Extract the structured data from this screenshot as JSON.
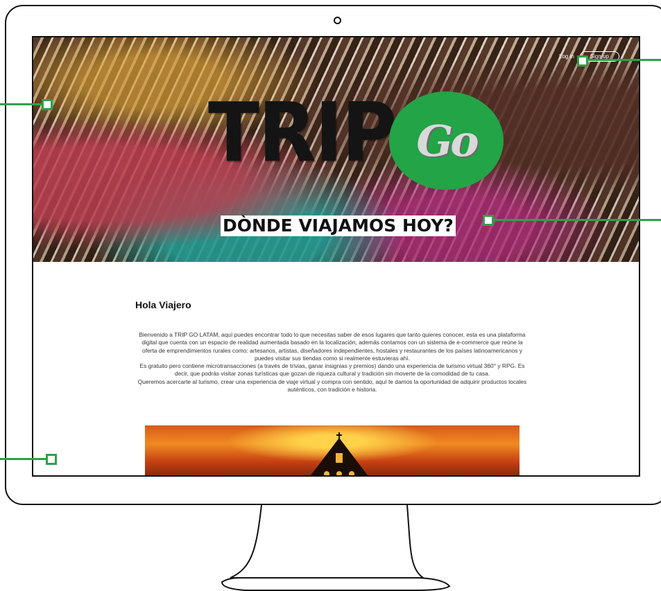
{
  "brand": {
    "logo_text": "TRIP",
    "logo_badge": "Go",
    "accent_color": "#22a447"
  },
  "hero": {
    "tagline": "DÒNDE VIAJAMOS HOY?"
  },
  "auth": {
    "login_label": "Log in",
    "signup_label": "Sign up"
  },
  "content": {
    "title": "Hola Viajero",
    "paragraphs": [
      "Bienvenido a TRIP GO LATAM, aquí puedes encontrar todo lo que necesitas saber de esos lugares que tanto quieres conocer, esta es una plataforma digital que cuenta con un espacio de realidad aumentada basado en la localización, además contamos con un sistema de e-commerce que reúne la oferta de emprendimientos rurales como: artesanos, artistas, diseñadores independientes, hostales y restaurantes de los países latinoamericanos y puedes visitar sus tiendas como si realmente estuvieras ahí.",
      "Es gratuito pero contiene microtransacciones (a través de trivias, ganar insignias y premios)  dando una experiencia de turismo virtual 360° y RPG. Es decir, que podrás visitar zonas turísticas que gozan de riqueza cultural y tradición sin moverte de la comodidad de tu casa.",
      "Queremos acercarte al turismo, crear una experiencia de viaje virtual y compra con sentido, aquí te damos la oportunidad de adquirir productos locales auténticos, con tradición e historia."
    ]
  },
  "annotation_color": "#2fa04a"
}
